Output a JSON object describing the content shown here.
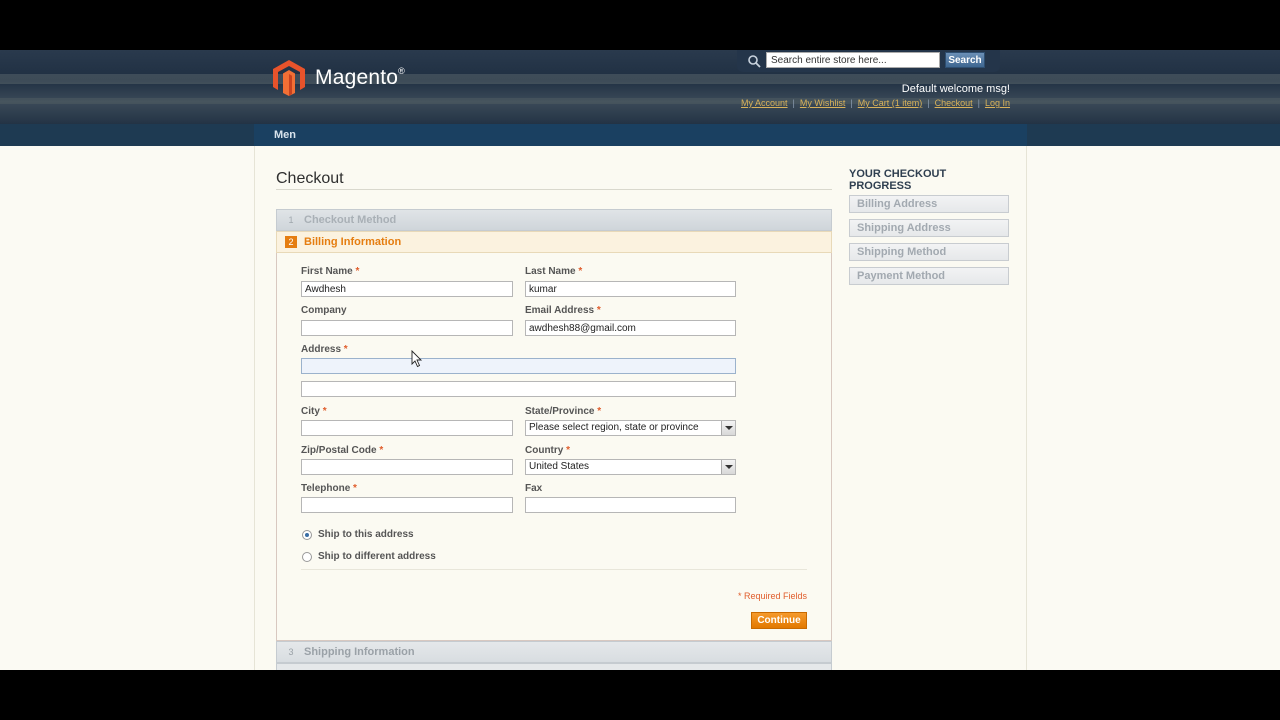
{
  "header": {
    "logo_text": "Magento",
    "logo_reg": "®",
    "search": {
      "placeholder": "Search entire store here...",
      "value": "Search entire store here...",
      "button_label": "Search"
    },
    "welcome": "Default welcome msg!",
    "links": [
      "My Account",
      "My Wishlist",
      "My Cart (1 item)",
      "Checkout",
      "Log In"
    ]
  },
  "nav": {
    "items": [
      "Men"
    ]
  },
  "page": {
    "title": "Checkout"
  },
  "steps": [
    {
      "num": "1",
      "label": "Checkout Method"
    },
    {
      "num": "2",
      "label": "Billing Information"
    },
    {
      "num": "3",
      "label": "Shipping Information"
    }
  ],
  "form": {
    "first_name": {
      "label": "First Name",
      "value": "Awdhesh"
    },
    "last_name": {
      "label": "Last Name",
      "value": "kumar"
    },
    "company": {
      "label": "Company",
      "value": ""
    },
    "email": {
      "label": "Email Address",
      "value": "awdhesh88@gmail.com"
    },
    "address": {
      "label": "Address",
      "line1": "",
      "line2": ""
    },
    "city": {
      "label": "City",
      "value": ""
    },
    "state": {
      "label": "State/Province",
      "value": "Please select region, state or province"
    },
    "zip": {
      "label": "Zip/Postal Code",
      "value": ""
    },
    "country": {
      "label": "Country",
      "value": "United States"
    },
    "telephone": {
      "label": "Telephone",
      "value": ""
    },
    "fax": {
      "label": "Fax",
      "value": ""
    },
    "ship_options": [
      "Ship to this address",
      "Ship to different address"
    ],
    "required_note": "* Required Fields",
    "continue_label": "Continue",
    "required_marker": "*"
  },
  "progress": {
    "title": "YOUR CHECKOUT PROGRESS",
    "items": [
      "Billing Address",
      "Shipping Address",
      "Shipping Method",
      "Payment Method"
    ]
  },
  "colors": {
    "accent": "#e57d10",
    "header": "#1f2f42",
    "nav": "#1a4061"
  }
}
